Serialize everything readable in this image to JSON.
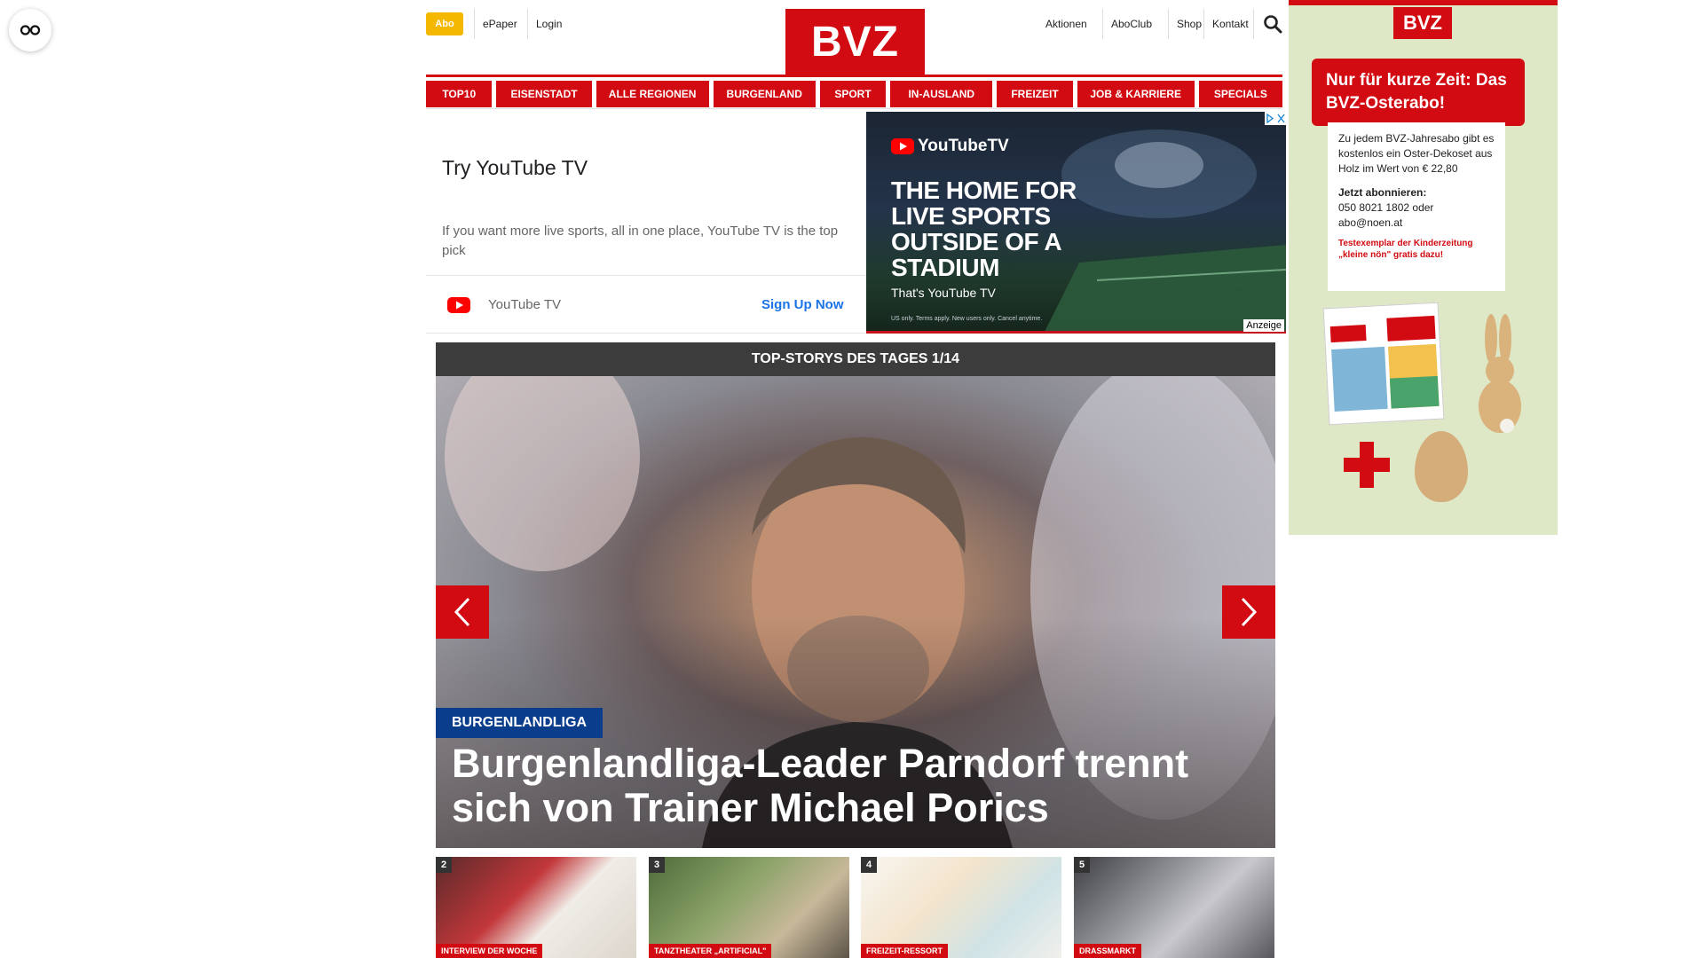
{
  "header": {
    "abo_label": "Abo",
    "links_left": [
      "ePaper",
      "Login"
    ],
    "logo_text": "BVZ",
    "links_right": [
      "Aktionen",
      "AboClub",
      "Shop",
      "Kontakt"
    ]
  },
  "nav": {
    "items": [
      "TOP10",
      "EISENSTADT",
      "ALLE REGIONEN",
      "BURGENLAND",
      "SPORT",
      "IN-AUSLAND",
      "FREIZEIT",
      "JOB & KARRIERE",
      "SPECIALS"
    ]
  },
  "ad": {
    "title": "Try YouTube TV",
    "description": "If you want more live sports, all in one place, YouTube TV is the top pick",
    "brand": "YouTube TV",
    "cta": "Sign Up Now",
    "image_logo": "YouTubeTV",
    "image_headline": "THE HOME FOR LIVE SPORTS OUTSIDE OF A STADIUM",
    "image_sub": "That's YouTube TV",
    "image_fine": "US only. Terms apply. New users only. Cancel anytime.",
    "label": "Anzeige"
  },
  "top_stories": {
    "header": "TOP-STORYS DES TAGES 1/14",
    "hero_category": "BURGENLANDLIGA",
    "hero_title": "Burgenlandliga-Leader Parndorf trennt sich von Trainer Michael Porics",
    "thumbs": [
      {
        "num": "2",
        "category": "INTERVIEW DER WOCHE"
      },
      {
        "num": "3",
        "category": "TANZTHEATER „ARTIFICIAL\""
      },
      {
        "num": "4",
        "category": "FREIZEIT-RESSORT"
      },
      {
        "num": "5",
        "category": "DRASSMARKT"
      }
    ]
  },
  "side_ad": {
    "logo": "BVZ",
    "headline": "Nur für kurze Zeit: Das BVZ-Osterabo!",
    "body": "Zu jedem BVZ-Jahresabo gibt es kostenlos ein Oster-Dekoset aus Holz im Wert von € 22,80",
    "cta_title": "Jetzt abonnieren:",
    "contact": "050 8021 1802 oder abo@noen.at",
    "note": "Testexemplar der Kinderzeitung „kleine nön\" gratis dazu!"
  },
  "colors": {
    "brand_red": "#d20a11",
    "abo_yellow": "#f5b800",
    "category_blue": "#0a3e8c",
    "link_blue": "#1a73e8"
  }
}
